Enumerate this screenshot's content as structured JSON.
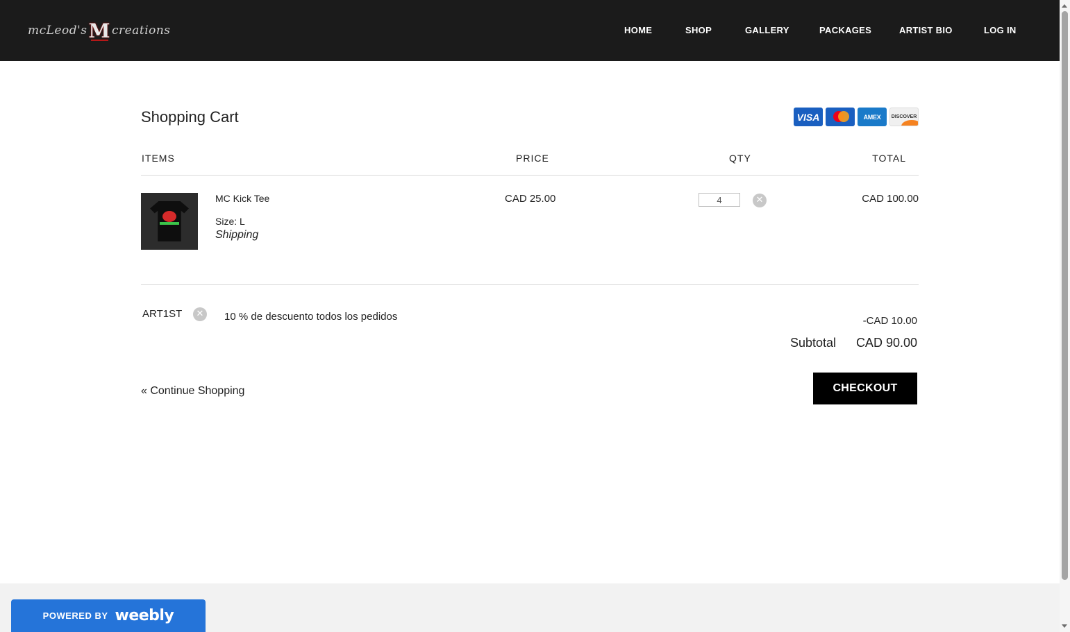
{
  "header": {
    "logo": {
      "left": "mcLeod's",
      "mark": "M",
      "right": "creations"
    },
    "nav": [
      "HOME",
      "SHOP",
      "GALLERY",
      "PACKAGES",
      "ARTIST BIO",
      "LOG IN"
    ]
  },
  "cart": {
    "title": "Shopping Cart",
    "payment_cards": [
      "VISA",
      "mastercard",
      "AMEX",
      "DISCOVER"
    ],
    "columns": [
      "ITEMS",
      "PRICE",
      "QTY",
      "TOTAL"
    ],
    "items": [
      {
        "name": "MC Kick Tee",
        "size": "Size: L",
        "note": "Shipping",
        "price": "CAD 25.00",
        "qty": "4",
        "total": "CAD 100.00"
      }
    ],
    "coupon": {
      "code": "ART1ST",
      "description": "10 % de descuento todos los pedidos",
      "amount": "-CAD 10.00"
    },
    "subtotal_label": "Subtotal",
    "subtotal_value": "CAD 90.00",
    "continue_label": "« Continue Shopping",
    "checkout_label": "CHECKOUT"
  },
  "footer": {
    "powered_by": "POWERED BY",
    "brand": "weebly"
  },
  "colors": {
    "header_bg": "#1b1b1b",
    "checkout_bg": "#000000",
    "weebly_blue": "#2574d9"
  }
}
